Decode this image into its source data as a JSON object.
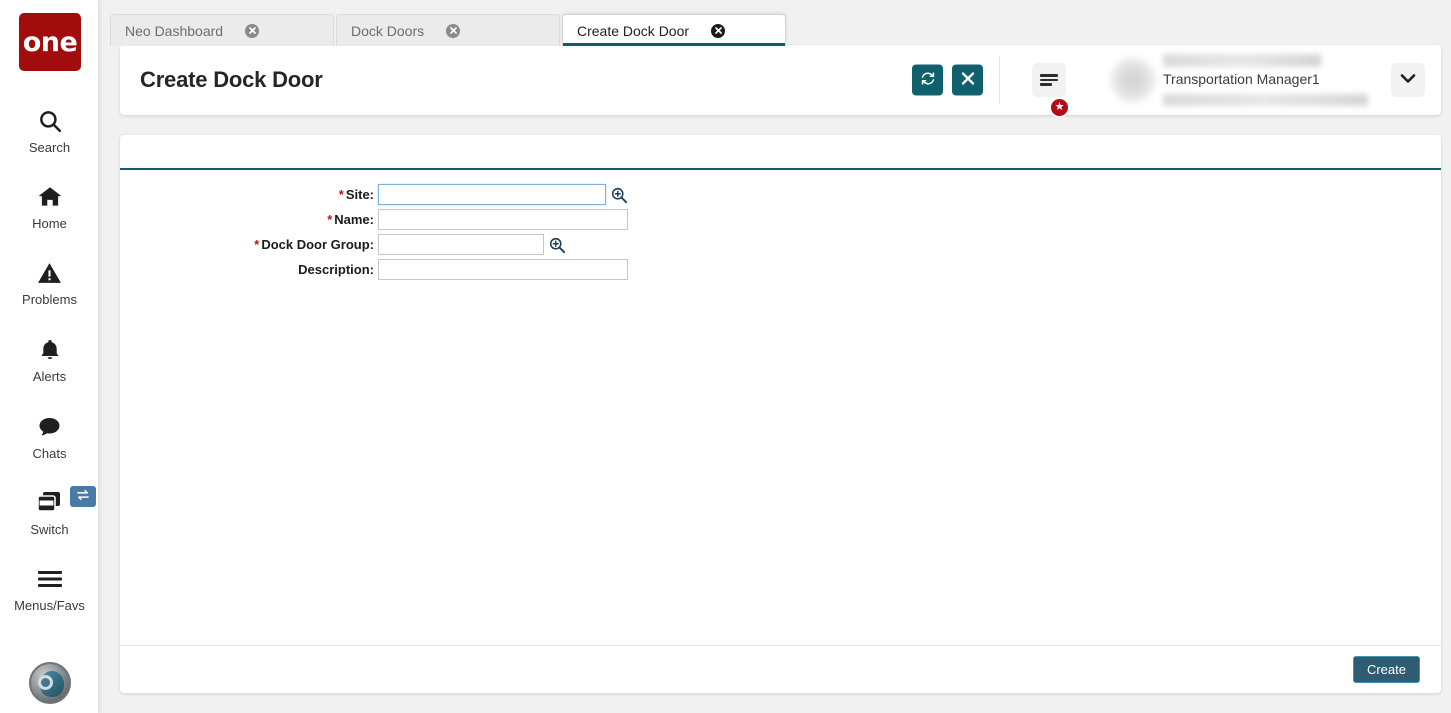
{
  "brand": {
    "logo_text": "one",
    "logo_color": "#a10c0c"
  },
  "sidebar": {
    "items": [
      {
        "label": "Search",
        "icon": "search-icon"
      },
      {
        "label": "Home",
        "icon": "home-icon"
      },
      {
        "label": "Problems",
        "icon": "warning-triangle-icon"
      },
      {
        "label": "Alerts",
        "icon": "bell-icon"
      },
      {
        "label": "Chats",
        "icon": "chat-bubble-icon"
      },
      {
        "label": "Switch",
        "icon": "windows-stack-icon"
      },
      {
        "label": "Menus/Favs",
        "icon": "hamburger-icon"
      }
    ],
    "switch_badge_icon": "swap-arrows-icon",
    "profile_avatar_icon": "user-avatar-icon"
  },
  "tabs": [
    {
      "label": "Neo Dashboard",
      "active": false,
      "close_icon": "close-circle-icon"
    },
    {
      "label": "Dock Doors",
      "active": false,
      "close_icon": "close-circle-icon"
    },
    {
      "label": "Create Dock Door",
      "active": true,
      "close_icon": "close-circle-icon"
    }
  ],
  "header": {
    "title": "Create Dock Door",
    "refresh_icon": "refresh-icon",
    "close_icon": "close-x-icon",
    "menu_icon": "hamburger-menu-icon",
    "favorites_badge_icon": "star-icon",
    "user_role": "Transportation Manager1",
    "user_name_redacted": "",
    "user_org_redacted": "",
    "caret_icon": "chevron-down-icon",
    "accent_color": "#10606e"
  },
  "form": {
    "fields": [
      {
        "label": "Site:",
        "required": true,
        "value": "",
        "placeholder": "",
        "has_lookup": true,
        "lookup_icon": "magnifier-plus-icon",
        "focused": true
      },
      {
        "label": "Name:",
        "required": true,
        "value": "",
        "placeholder": "",
        "has_lookup": false,
        "focused": false
      },
      {
        "label": "Dock Door Group:",
        "required": true,
        "value": "",
        "placeholder": "",
        "has_lookup": true,
        "lookup_icon": "magnifier-plus-icon",
        "focused": false
      },
      {
        "label": "Description:",
        "required": false,
        "value": "",
        "placeholder": "",
        "has_lookup": false,
        "focused": false
      }
    ],
    "required_marker": "*"
  },
  "footer": {
    "create_label": "Create"
  }
}
